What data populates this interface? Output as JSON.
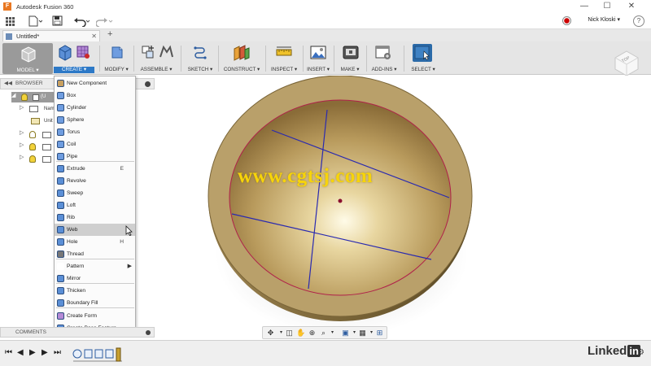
{
  "window": {
    "title": "Autodesk Fusion 360",
    "app_badge": "F",
    "min": "—",
    "max": "☐",
    "close": "✕"
  },
  "quick_access": {
    "user": "Nick Kloski ▾",
    "help": "?"
  },
  "tabs": [
    {
      "label": "Untitled*"
    }
  ],
  "toolbar": {
    "workspace": "MODEL ▾",
    "groups": [
      "CREATE ▾",
      "MODIFY ▾",
      "ASSEMBLE ▾",
      "SKETCH ▾",
      "CONSTRUCT ▾",
      "INSPECT ▾",
      "INSERT ▾",
      "MAKE ▾",
      "ADD-INS ▾",
      "SELECT ▾"
    ]
  },
  "viewcube": {
    "face": "TOP"
  },
  "browser": {
    "title": "BROWSER",
    "rows": [
      {
        "label": "(U"
      },
      {
        "label": "Nam"
      },
      {
        "label": "Unit"
      }
    ]
  },
  "create_menu": {
    "items": [
      {
        "label": "New Component",
        "shortcut": ""
      },
      {
        "label": "Box",
        "shortcut": ""
      },
      {
        "label": "Cylinder",
        "shortcut": ""
      },
      {
        "label": "Sphere",
        "shortcut": ""
      },
      {
        "label": "Torus",
        "shortcut": ""
      },
      {
        "label": "Coil",
        "shortcut": ""
      },
      {
        "label": "Pipe",
        "shortcut": ""
      },
      {
        "label": "Extrude",
        "shortcut": "E"
      },
      {
        "label": "Revolve",
        "shortcut": ""
      },
      {
        "label": "Sweep",
        "shortcut": ""
      },
      {
        "label": "Loft",
        "shortcut": ""
      },
      {
        "label": "Rib",
        "shortcut": ""
      },
      {
        "label": "Web",
        "shortcut": ""
      },
      {
        "label": "Hole",
        "shortcut": "H"
      },
      {
        "label": "Thread",
        "shortcut": ""
      },
      {
        "label": "Pattern",
        "shortcut": ""
      },
      {
        "label": "Mirror",
        "shortcut": ""
      },
      {
        "label": "Thicken",
        "shortcut": ""
      },
      {
        "label": "Boundary Fill",
        "shortcut": ""
      },
      {
        "label": "Create Form",
        "shortcut": ""
      },
      {
        "label": "Create Base Feature",
        "shortcut": ""
      }
    ],
    "highlighted": "Web",
    "submenu_arrow": "▶"
  },
  "comments": {
    "title": "COMMENTS"
  },
  "watermark": "www.cgtsj.com",
  "branding": {
    "text": "Linked",
    "badge": "in"
  },
  "colors": {
    "accent": "#2d79c7",
    "bowl_rim": "#b9a06a",
    "sketch_line": "#2a2ab0",
    "menu_highlight": "#cfcfcf"
  }
}
